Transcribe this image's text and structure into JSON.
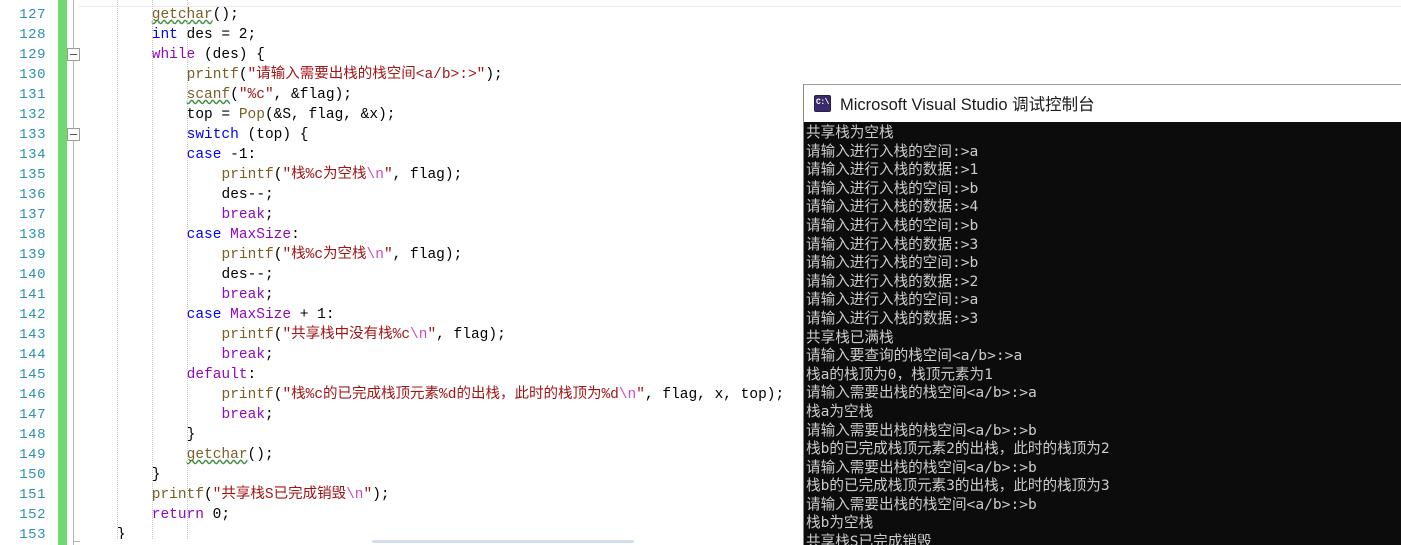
{
  "editor": {
    "first_line_number": 127,
    "lines": [
      {
        "n": 127,
        "indent": 2,
        "tokens": [
          {
            "t": "getchar",
            "c": "fn squig"
          },
          {
            "t": "();",
            "c": "pun"
          }
        ]
      },
      {
        "n": 128,
        "indent": 2,
        "tokens": [
          {
            "t": "int",
            "c": "kw"
          },
          {
            "t": " des = ",
            "c": "id"
          },
          {
            "t": "2",
            "c": "num"
          },
          {
            "t": ";",
            "c": "pun"
          }
        ]
      },
      {
        "n": 129,
        "indent": 2,
        "tokens": [
          {
            "t": "while",
            "c": "kw2"
          },
          {
            "t": " (des) {",
            "c": "pun"
          }
        ]
      },
      {
        "n": 130,
        "indent": 3,
        "tokens": [
          {
            "t": "printf",
            "c": "fn"
          },
          {
            "t": "(",
            "c": "pun"
          },
          {
            "t": "\"请输入需要出栈的栈空间<a/b>:>\"",
            "c": "str"
          },
          {
            "t": ");",
            "c": "pun"
          }
        ]
      },
      {
        "n": 131,
        "indent": 3,
        "tokens": [
          {
            "t": "scanf",
            "c": "fn squig"
          },
          {
            "t": "(",
            "c": "pun"
          },
          {
            "t": "\"%c\"",
            "c": "str"
          },
          {
            "t": ", &flag);",
            "c": "pun"
          }
        ]
      },
      {
        "n": 132,
        "indent": 3,
        "tokens": [
          {
            "t": "top = ",
            "c": "id"
          },
          {
            "t": "Pop",
            "c": "fn"
          },
          {
            "t": "(&S, flag, &x);",
            "c": "pun"
          }
        ]
      },
      {
        "n": 133,
        "indent": 3,
        "tokens": [
          {
            "t": "switch",
            "c": "kw"
          },
          {
            "t": " (top) {",
            "c": "pun"
          }
        ]
      },
      {
        "n": 134,
        "indent": 3,
        "tokens": [
          {
            "t": "case",
            "c": "kw"
          },
          {
            "t": " -",
            "c": "pun"
          },
          {
            "t": "1",
            "c": "num"
          },
          {
            "t": ":",
            "c": "pun"
          }
        ]
      },
      {
        "n": 135,
        "indent": 4,
        "tokens": [
          {
            "t": "printf",
            "c": "fn"
          },
          {
            "t": "(",
            "c": "pun"
          },
          {
            "t": "\"栈%c为空栈",
            "c": "str"
          },
          {
            "t": "\\n",
            "c": "esc"
          },
          {
            "t": "\"",
            "c": "str"
          },
          {
            "t": ", flag);",
            "c": "pun"
          }
        ]
      },
      {
        "n": 136,
        "indent": 4,
        "tokens": [
          {
            "t": "des--;",
            "c": "id"
          }
        ]
      },
      {
        "n": 137,
        "indent": 4,
        "tokens": [
          {
            "t": "break",
            "c": "kw2"
          },
          {
            "t": ";",
            "c": "pun"
          }
        ]
      },
      {
        "n": 138,
        "indent": 3,
        "tokens": [
          {
            "t": "case",
            "c": "kw"
          },
          {
            "t": " ",
            "c": "pun"
          },
          {
            "t": "MaxSize",
            "c": "macro"
          },
          {
            "t": ":",
            "c": "pun"
          }
        ]
      },
      {
        "n": 139,
        "indent": 4,
        "tokens": [
          {
            "t": "printf",
            "c": "fn"
          },
          {
            "t": "(",
            "c": "pun"
          },
          {
            "t": "\"栈%c为空栈",
            "c": "str"
          },
          {
            "t": "\\n",
            "c": "esc"
          },
          {
            "t": "\"",
            "c": "str"
          },
          {
            "t": ", flag);",
            "c": "pun"
          }
        ]
      },
      {
        "n": 140,
        "indent": 4,
        "tokens": [
          {
            "t": "des--;",
            "c": "id"
          }
        ]
      },
      {
        "n": 141,
        "indent": 4,
        "tokens": [
          {
            "t": "break",
            "c": "kw2"
          },
          {
            "t": ";",
            "c": "pun"
          }
        ]
      },
      {
        "n": 142,
        "indent": 3,
        "tokens": [
          {
            "t": "case",
            "c": "kw"
          },
          {
            "t": " ",
            "c": "pun"
          },
          {
            "t": "MaxSize",
            "c": "macro"
          },
          {
            "t": " + ",
            "c": "pun"
          },
          {
            "t": "1",
            "c": "num"
          },
          {
            "t": ":",
            "c": "pun"
          }
        ]
      },
      {
        "n": 143,
        "indent": 4,
        "tokens": [
          {
            "t": "printf",
            "c": "fn"
          },
          {
            "t": "(",
            "c": "pun"
          },
          {
            "t": "\"共享栈中没有栈%c",
            "c": "str"
          },
          {
            "t": "\\n",
            "c": "esc"
          },
          {
            "t": "\"",
            "c": "str"
          },
          {
            "t": ", flag);",
            "c": "pun"
          }
        ]
      },
      {
        "n": 144,
        "indent": 4,
        "tokens": [
          {
            "t": "break",
            "c": "kw2"
          },
          {
            "t": ";",
            "c": "pun"
          }
        ]
      },
      {
        "n": 145,
        "indent": 3,
        "tokens": [
          {
            "t": "default",
            "c": "kw2"
          },
          {
            "t": ":",
            "c": "pun"
          }
        ]
      },
      {
        "n": 146,
        "indent": 4,
        "tokens": [
          {
            "t": "printf",
            "c": "fn"
          },
          {
            "t": "(",
            "c": "pun"
          },
          {
            "t": "\"栈%c的已完成栈顶元素%d的出栈，此时的栈顶为%d",
            "c": "str"
          },
          {
            "t": "\\n",
            "c": "esc"
          },
          {
            "t": "\"",
            "c": "str"
          },
          {
            "t": ", flag, x, top);",
            "c": "pun"
          }
        ]
      },
      {
        "n": 147,
        "indent": 4,
        "tokens": [
          {
            "t": "break",
            "c": "kw2"
          },
          {
            "t": ";",
            "c": "pun"
          }
        ]
      },
      {
        "n": 148,
        "indent": 3,
        "tokens": [
          {
            "t": "}",
            "c": "pun"
          }
        ]
      },
      {
        "n": 149,
        "indent": 3,
        "tokens": [
          {
            "t": "getchar",
            "c": "fn squig"
          },
          {
            "t": "();",
            "c": "pun"
          }
        ]
      },
      {
        "n": 150,
        "indent": 2,
        "tokens": [
          {
            "t": "}",
            "c": "pun"
          }
        ]
      },
      {
        "n": 151,
        "indent": 2,
        "tokens": [
          {
            "t": "printf",
            "c": "fn"
          },
          {
            "t": "(",
            "c": "pun"
          },
          {
            "t": "\"共享栈S已完成销毁",
            "c": "str"
          },
          {
            "t": "\\n",
            "c": "esc"
          },
          {
            "t": "\"",
            "c": "str"
          },
          {
            "t": ");",
            "c": "pun"
          }
        ]
      },
      {
        "n": 152,
        "indent": 2,
        "tokens": [
          {
            "t": "return",
            "c": "kw2"
          },
          {
            "t": " ",
            "c": "pun"
          },
          {
            "t": "0",
            "c": "num"
          },
          {
            "t": ";",
            "c": "pun"
          }
        ]
      },
      {
        "n": 153,
        "indent": 1,
        "tokens": [
          {
            "t": "}",
            "c": "pun"
          }
        ]
      }
    ],
    "fold_markers": [
      {
        "line": 129,
        "glyph": "collapse-minus"
      },
      {
        "line": 133,
        "glyph": "collapse-minus"
      }
    ],
    "change_bar_color": "#6fd96f",
    "line_number_color": "#2b91af",
    "string_color": "#a31515",
    "keyword_color": "#0000ff",
    "control_keyword_color": "#8f08c4",
    "function_color": "#795e26",
    "escape_color": "#c64cc6",
    "background_color": "#ffffff"
  },
  "console": {
    "title": "Microsoft Visual Studio 调试控制台",
    "icon_label": "C:\\",
    "background_color": "#0c0c0c",
    "text_color": "#cccccc",
    "titlebar_color": "#ffffff",
    "output_lines": [
      "共享栈为空栈",
      "请输入进行入栈的空间:>a",
      "请输入进行入栈的数据:>1",
      "请输入进行入栈的空间:>b",
      "请输入进行入栈的数据:>4",
      "请输入进行入栈的空间:>b",
      "请输入进行入栈的数据:>3",
      "请输入进行入栈的空间:>b",
      "请输入进行入栈的数据:>2",
      "请输入进行入栈的空间:>a",
      "请输入进行入栈的数据:>3",
      "共享栈已满栈",
      "请输入要查询的栈空间<a/b>:>a",
      "栈a的栈顶为0，栈顶元素为1",
      "请输入需要出栈的栈空间<a/b>:>a",
      "栈a为空栈",
      "请输入需要出栈的栈空间<a/b>:>b",
      "栈b的已完成栈顶元素2的出栈，此时的栈顶为2",
      "请输入需要出栈的栈空间<a/b>:>b",
      "栈b的已完成栈顶元素3的出栈，此时的栈顶为3",
      "请输入需要出栈的栈空间<a/b>:>b",
      "栈b为空栈",
      "共享栈S已完成销毁"
    ]
  },
  "scrollbar": {
    "horizontal_thumb_color": "#d6ddef"
  }
}
